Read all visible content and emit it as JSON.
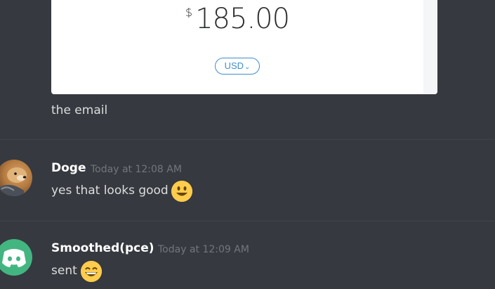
{
  "embed": {
    "currency_symbol": "$",
    "amount": "185.00",
    "currency_code": "USD"
  },
  "messages": [
    {
      "text": "the email"
    },
    {
      "author": "Doge",
      "timestamp": "Today at 12:08 AM",
      "text": "yes that looks good",
      "emoji": "smiley-emoji"
    },
    {
      "author": "Smoothed(pce)",
      "timestamp": "Today at 12:09 AM",
      "text": "sent",
      "emoji": "grinning-emoji"
    }
  ],
  "colors": {
    "background": "#36393f",
    "username": "#ffffff",
    "timestamp": "#72767d",
    "message_text": "#dcddde",
    "currency_pill": "#3e8dd0",
    "discord_green": "#43b581",
    "emoji_yellow": "#ffcc4d"
  }
}
